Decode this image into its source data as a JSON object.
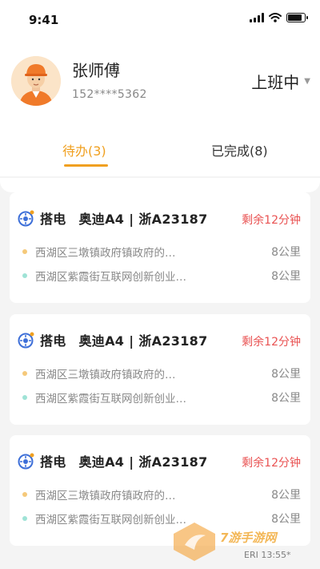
{
  "status_bar": {
    "time": "9:41"
  },
  "profile": {
    "name": "张师傅",
    "phone": "152****5362",
    "work_status": "上班中"
  },
  "tabs": [
    {
      "label": "待办(3)",
      "active": true
    },
    {
      "label": "已完成(8)",
      "active": false
    }
  ],
  "colors": {
    "accent": "#f0a020",
    "remaining": "#e95252",
    "start_dot": "#f5c97a",
    "end_dot": "#9fe3d6"
  },
  "orders": [
    {
      "type": "搭电",
      "car": "奥迪A4",
      "plate": "浙A23187",
      "remaining": "剩余12分钟",
      "from": {
        "address": "西湖区三墩镇政府镇政府的…",
        "distance": "8公里"
      },
      "to": {
        "address": "西湖区紫霞街互联网创新创业…",
        "distance": "8公里"
      }
    },
    {
      "type": "搭电",
      "car": "奥迪A4",
      "plate": "浙A23187",
      "remaining": "剩余12分钟",
      "from": {
        "address": "西湖区三墩镇政府镇政府的…",
        "distance": "8公里"
      },
      "to": {
        "address": "西湖区紫霞街互联网创新创业…",
        "distance": "8公里"
      }
    },
    {
      "type": "搭电",
      "car": "奥迪A4",
      "plate": "浙A23187",
      "remaining": "剩余12分钟",
      "from": {
        "address": "西湖区三墩镇政府镇政府的…",
        "distance": "8公里"
      },
      "to": {
        "address": "西湖区紫霞街互联网创新创业…",
        "distance": "8公里"
      }
    }
  ],
  "watermark": {
    "text": "7游手游网",
    "sub": "ERI 13:55*"
  }
}
